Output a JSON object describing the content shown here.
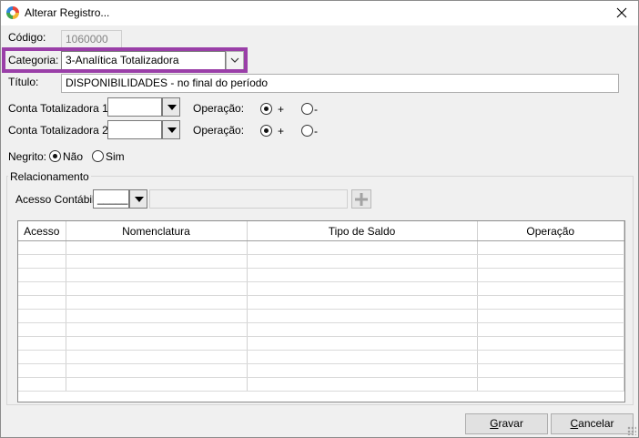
{
  "window": {
    "title": "Alterar Registro..."
  },
  "form": {
    "codigo_label": "Código:",
    "codigo_value": "1060000",
    "categoria_label": "Categoria:",
    "categoria_value": "3-Analítica Totalizadora",
    "titulo_label": "Título:",
    "titulo_value": "DISPONIBILIDADES - no final do período",
    "conta1_label": "Conta Totalizadora 1:",
    "conta1_value": "",
    "conta2_label": "Conta Totalizadora 2:",
    "conta2_value": "",
    "operacao_label": "Operação:",
    "op_plus": "+",
    "op_minus": "-",
    "op1_selected": "+",
    "op2_selected": "+",
    "negrito_label": "Negrito:",
    "negrito_nao": "Não",
    "negrito_sim": "Sim",
    "negrito_selected": "Não"
  },
  "relacionamento": {
    "title": "Relacionamento",
    "acesso_label": "Acesso Contábil:",
    "acesso_value": "_____",
    "acesso_desc": "",
    "add_icon": "plus-icon"
  },
  "grid": {
    "columns": [
      "Acesso",
      "Nomenclatura",
      "Tipo de Saldo",
      "Operação"
    ],
    "rows": [
      [
        "",
        "",
        "",
        ""
      ],
      [
        "",
        "",
        "",
        ""
      ],
      [
        "",
        "",
        "",
        ""
      ],
      [
        "",
        "",
        "",
        ""
      ],
      [
        "",
        "",
        "",
        ""
      ],
      [
        "",
        "",
        "",
        ""
      ],
      [
        "",
        "",
        "",
        ""
      ],
      [
        "",
        "",
        "",
        ""
      ],
      [
        "",
        "",
        "",
        ""
      ],
      [
        "",
        "",
        "",
        ""
      ],
      [
        "",
        "",
        "",
        ""
      ]
    ]
  },
  "buttons": {
    "gravar_prefix": "G",
    "gravar_rest": "ravar",
    "cancelar_prefix": "C",
    "cancelar_rest": "ancelar"
  },
  "colors": {
    "highlight": "#9a3fa8",
    "window_bg": "#f0f0f0"
  }
}
